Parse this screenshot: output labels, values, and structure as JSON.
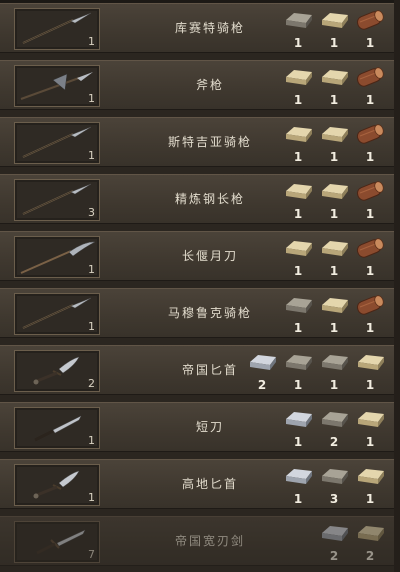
{
  "crafting_list": {
    "items": [
      {
        "name": "库赛特骑枪",
        "count": "1",
        "weapon": "spear",
        "dim": false,
        "materials": [
          {
            "type": "iron-ingot-icon",
            "qty": "1"
          },
          {
            "type": "steel-ingot-icon",
            "qty": "1"
          },
          {
            "type": "wood-log-icon",
            "qty": "1"
          }
        ]
      },
      {
        "name": "斧枪",
        "count": "1",
        "weapon": "halberd",
        "dim": false,
        "materials": [
          {
            "type": "steel-ingot-icon",
            "qty": "1"
          },
          {
            "type": "steel-ingot-icon",
            "qty": "1"
          },
          {
            "type": "wood-log-icon",
            "qty": "1"
          }
        ]
      },
      {
        "name": "斯特吉亚骑枪",
        "count": "1",
        "weapon": "spear",
        "dim": false,
        "materials": [
          {
            "type": "steel-ingot-icon",
            "qty": "1"
          },
          {
            "type": "steel-ingot-icon",
            "qty": "1"
          },
          {
            "type": "wood-log-icon",
            "qty": "1"
          }
        ]
      },
      {
        "name": "精炼钢长枪",
        "count": "3",
        "weapon": "spear",
        "dim": false,
        "materials": [
          {
            "type": "steel-ingot-icon",
            "qty": "1"
          },
          {
            "type": "steel-ingot-icon",
            "qty": "1"
          },
          {
            "type": "wood-log-icon",
            "qty": "1"
          }
        ]
      },
      {
        "name": "长偃月刀",
        "count": "1",
        "weapon": "glaive",
        "dim": false,
        "materials": [
          {
            "type": "steel-ingot-icon",
            "qty": "1"
          },
          {
            "type": "steel-ingot-icon",
            "qty": "1"
          },
          {
            "type": "wood-log-icon",
            "qty": "1"
          }
        ]
      },
      {
        "name": "马穆鲁克骑枪",
        "count": "1",
        "weapon": "spear",
        "dim": false,
        "materials": [
          {
            "type": "iron-ingot-icon",
            "qty": "1"
          },
          {
            "type": "steel-ingot-icon",
            "qty": "1"
          },
          {
            "type": "wood-log-icon",
            "qty": "1"
          }
        ]
      },
      {
        "name": "帝国匕首",
        "count": "2",
        "weapon": "dagger",
        "dim": false,
        "materials": [
          {
            "type": "fine-steel-ingot-icon",
            "qty": "2"
          },
          {
            "type": "iron-ingot-icon",
            "qty": "1"
          },
          {
            "type": "iron-ingot-icon",
            "qty": "1"
          },
          {
            "type": "steel-ingot-icon",
            "qty": "1"
          }
        ]
      },
      {
        "name": "短刀",
        "count": "1",
        "weapon": "knife",
        "dim": false,
        "materials": [
          {
            "type": "fine-steel-ingot-icon",
            "qty": "1"
          },
          {
            "type": "iron-ingot-icon",
            "qty": "2"
          },
          {
            "type": "steel-ingot-icon",
            "qty": "1"
          }
        ]
      },
      {
        "name": "高地匕首",
        "count": "1",
        "weapon": "dagger",
        "dim": false,
        "materials": [
          {
            "type": "fine-steel-ingot-icon",
            "qty": "1"
          },
          {
            "type": "iron-ingot-icon",
            "qty": "3"
          },
          {
            "type": "steel-ingot-icon",
            "qty": "1"
          }
        ]
      },
      {
        "name": "帝国宽刃剑",
        "count": "7",
        "weapon": "sword",
        "dim": true,
        "materials": [
          {
            "type": "fine-steel-ingot-icon",
            "qty": "2"
          },
          {
            "type": "steel-ingot-icon",
            "qty": "2"
          }
        ]
      }
    ]
  },
  "colors": {
    "row_bg": "#433b32",
    "steel_ingot": "#c9b98f",
    "iron_ingot": "#8d877c",
    "fine_steel_ingot": "#a9aeb8",
    "wood": "#8a4a2c"
  }
}
